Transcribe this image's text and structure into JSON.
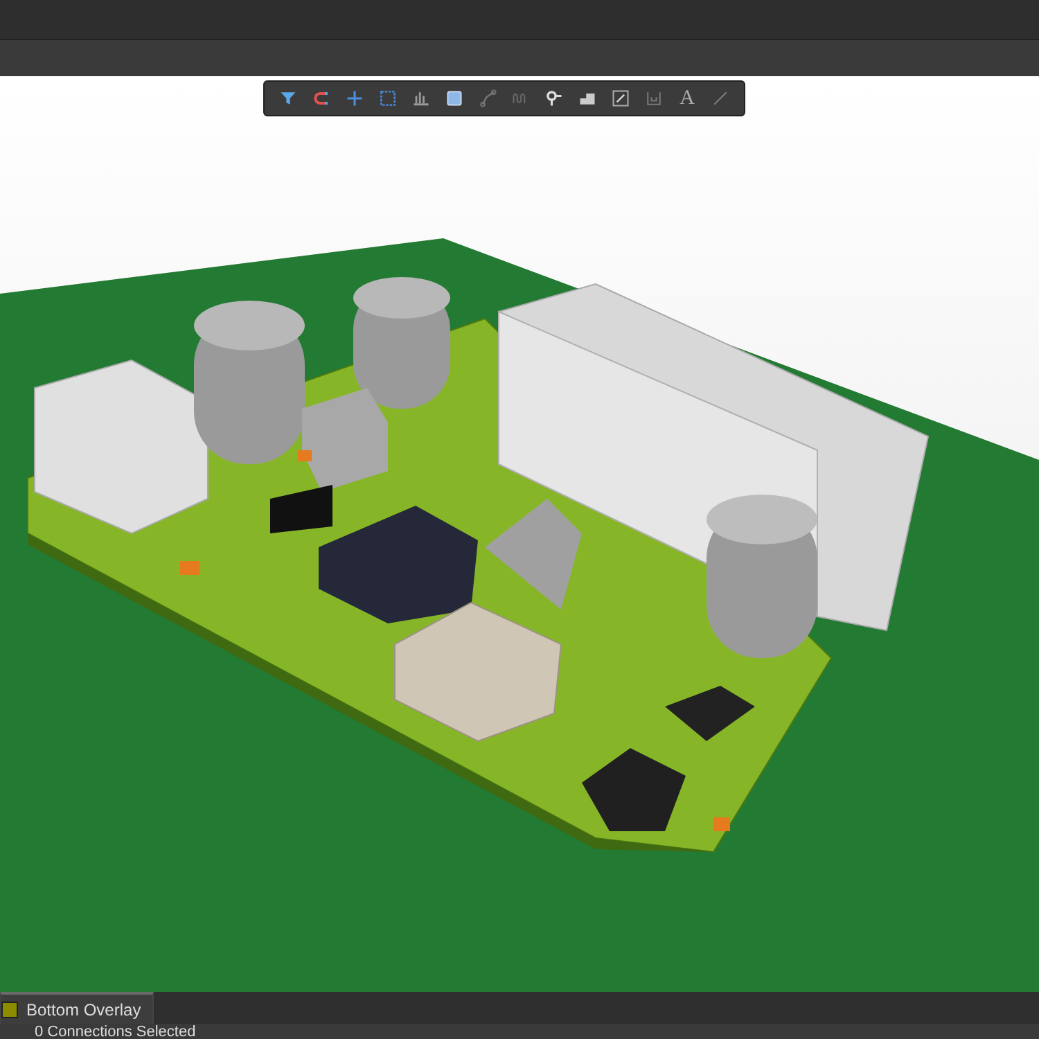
{
  "toolbar": {
    "tools": [
      {
        "kind": "filter"
      },
      {
        "kind": "magnet"
      },
      {
        "kind": "cross"
      },
      {
        "kind": "rect"
      },
      {
        "kind": "bars"
      },
      {
        "kind": "fill"
      },
      {
        "kind": "route"
      },
      {
        "kind": "wave"
      },
      {
        "kind": "pin"
      },
      {
        "kind": "step"
      },
      {
        "kind": "box"
      },
      {
        "kind": "bracket"
      },
      {
        "kind": "text",
        "label": "A"
      },
      {
        "kind": "line"
      }
    ]
  },
  "layer_tabs": [
    {
      "label": "Bottom Overlay",
      "color": "#8c8c00",
      "selected": true
    }
  ],
  "status_bar": {
    "text": "0 Connections Selected"
  }
}
